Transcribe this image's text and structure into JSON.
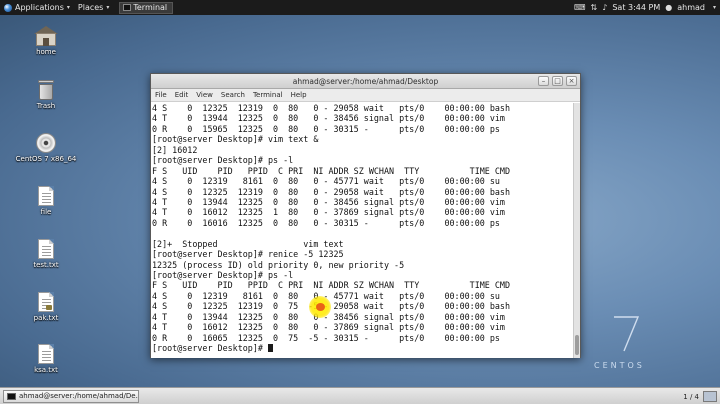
{
  "top_panel": {
    "applications": "Applications",
    "places": "Places",
    "task": "Terminal",
    "clock": "Sat  3:44 PM",
    "user": "ahmad"
  },
  "desktop": {
    "icons": [
      {
        "label": "home",
        "icon": "home-folder-icon"
      },
      {
        "label": "Trash",
        "icon": "trash-icon"
      },
      {
        "label": "CentOS 7 x86_64",
        "icon": "disc-icon"
      },
      {
        "label": "file",
        "icon": "document-icon"
      },
      {
        "label": "test.txt",
        "icon": "document-icon"
      },
      {
        "label": "pak.txt",
        "icon": "locked-document-icon"
      },
      {
        "label": "ksa.txt",
        "icon": "document-icon"
      }
    ],
    "brand": "CENTOS",
    "brand_numeral": "7"
  },
  "terminal": {
    "title": "ahmad@server:/home/ahmad/Desktop",
    "menu": [
      "File",
      "Edit",
      "View",
      "Search",
      "Terminal",
      "Help"
    ],
    "lines": [
      "4 S    0  12325  12319  0  80   0 - 29058 wait   pts/0    00:00:00 bash",
      "4 T    0  13944  12325  0  80   0 - 38456 signal pts/0    00:00:00 vim",
      "0 R    0  15965  12325  0  80   0 - 30315 -      pts/0    00:00:00 ps",
      "[root@server Desktop]# vim text &",
      "[2] 16012",
      "[root@server Desktop]# ps -l",
      "F S   UID    PID   PPID  C PRI  NI ADDR SZ WCHAN  TTY          TIME CMD",
      "4 S    0  12319   8161  0  80   0 - 45771 wait   pts/0    00:00:00 su",
      "4 S    0  12325  12319  0  80   0 - 29058 wait   pts/0    00:00:00 bash",
      "4 T    0  13944  12325  0  80   0 - 38456 signal pts/0    00:00:00 vim",
      "4 T    0  16012  12325  1  80   0 - 37869 signal pts/0    00:00:00 vim",
      "0 R    0  16016  12325  0  80   0 - 30315 -      pts/0    00:00:00 ps",
      "",
      "[2]+  Stopped                 vim text",
      "[root@server Desktop]# renice -5 12325",
      "12325 (process ID) old priority 0, new priority -5",
      "[root@server Desktop]# ps -l",
      "F S   UID    PID   PPID  C PRI  NI ADDR SZ WCHAN  TTY          TIME CMD",
      "4 S    0  12319   8161  0  80   0 - 45771 wait   pts/0    00:00:00 su",
      "4 S    0  12325  12319  0  75  -5 - 29058 wait   pts/0    00:00:00 bash",
      "4 T    0  13944  12325  0  80   0 - 38456 signal pts/0    00:00:00 vim",
      "4 T    0  16012  12325  0  80   0 - 37869 signal pts/0    00:00:00 vim",
      "0 R    0  16065  12325  0  75  -5 - 30315 -      pts/0    00:00:00 ps",
      "[root@server Desktop]# "
    ]
  },
  "bottom_panel": {
    "task": "ahmad@server:/home/ahmad/De...",
    "workspace": "1 / 4"
  },
  "colors": {
    "desktop": "#6a8db4",
    "panel": "#1b1b1b",
    "highlight": "#ffe800"
  }
}
